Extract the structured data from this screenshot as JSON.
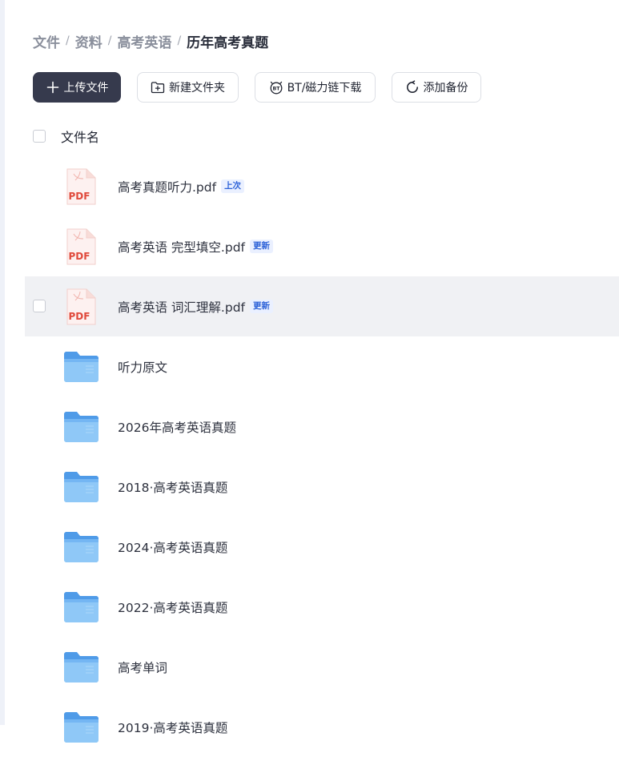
{
  "breadcrumb": {
    "items": [
      "文件",
      "资料",
      "高考英语"
    ],
    "current": "历年高考真题",
    "separator": "/"
  },
  "toolbar": {
    "upload_label": "上传文件",
    "new_folder_label": "新建文件夹",
    "bt_label": "BT/磁力链下载",
    "backup_label": "添加备份"
  },
  "list_header": {
    "name_label": "文件名"
  },
  "files": [
    {
      "name": "高考真题听力.pdf",
      "type": "pdf",
      "badge": "上次"
    },
    {
      "name": "高考英语 完型填空.pdf",
      "type": "pdf",
      "badge": "更新"
    },
    {
      "name": "高考英语 词汇理解.pdf",
      "type": "pdf",
      "badge": "更新"
    },
    {
      "name": "听力原文",
      "type": "folder"
    },
    {
      "name": "2026年高考英语真题",
      "type": "folder"
    },
    {
      "name": "2018·高考英语真题",
      "type": "folder"
    },
    {
      "name": "2024·高考英语真题",
      "type": "folder"
    },
    {
      "name": "2022·高考英语真题",
      "type": "folder"
    },
    {
      "name": "高考单词",
      "type": "folder"
    },
    {
      "name": "2019·高考英语真题",
      "type": "folder"
    }
  ],
  "colors": {
    "primary_button": "#363a4d",
    "hover_row": "#f0f1f4",
    "badge_text": "#2e63d8",
    "pdf_red": "#e04a3c",
    "folder_blue": "#5aa6ee"
  },
  "icons": {
    "upload": "plus-icon",
    "new_folder": "folder-plus-icon",
    "bt": "bt-icon",
    "backup": "sync-icon",
    "pdf": "pdf-file-icon",
    "folder": "folder-icon"
  }
}
